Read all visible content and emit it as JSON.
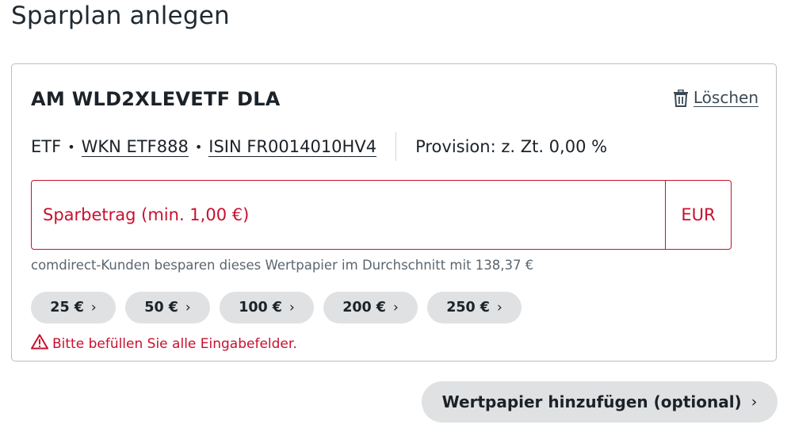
{
  "page": {
    "title": "Sparplan anlegen"
  },
  "card": {
    "product_name": "AM WLD2XLEVETF DLA",
    "delete_label": "Löschen",
    "meta": {
      "type": "ETF",
      "separator": "•",
      "wkn": "WKN ETF888",
      "isin": "ISIN FR0014010HV4",
      "commission": "Provision: z. Zt. 0,00 %"
    },
    "amount_field": {
      "value": "",
      "placeholder": "Sparbetrag (min. 1,00 €)",
      "currency": "EUR"
    },
    "hint": "comdirect-Kunden besparen dieses Wertpapier im Durchschnitt mit 138,37 €",
    "chips": [
      {
        "label": "25 €"
      },
      {
        "label": "50 €"
      },
      {
        "label": "100 €"
      },
      {
        "label": "200 €"
      },
      {
        "label": "250 €"
      }
    ],
    "chip_chevron": "›",
    "error": "Bitte befüllen Sie alle Eingabefelder."
  },
  "add_button": {
    "label": "Wertpapier hinzufügen (optional)",
    "chevron": "›"
  },
  "colors": {
    "error": "#c8102e",
    "chip_bg": "#dfe1e3",
    "text": "#1b2228",
    "muted": "#5b666f",
    "border": "#b8bec4"
  },
  "icons": {
    "delete": "trash-icon",
    "warning": "warning-triangle-icon",
    "chevron": "chevron-right-icon"
  }
}
